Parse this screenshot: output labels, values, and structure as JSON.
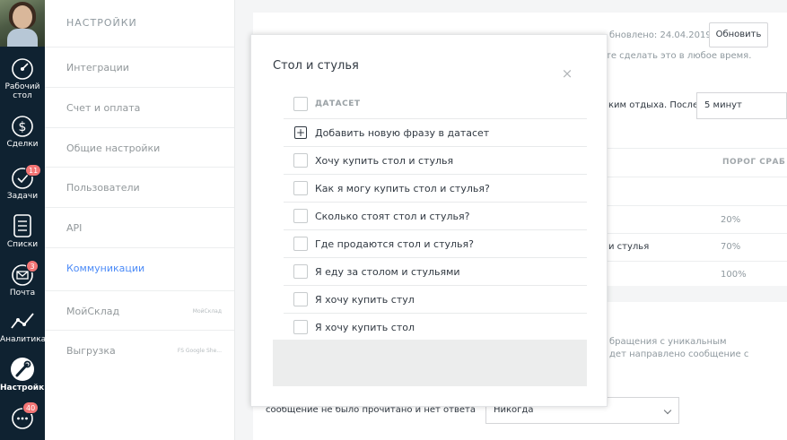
{
  "rail": {
    "items": [
      {
        "label": "Рабочий стол"
      },
      {
        "label": "Сделки"
      },
      {
        "label": "Задачи",
        "badge": "11"
      },
      {
        "label": "Списки"
      },
      {
        "label": "Почта",
        "badge": "3"
      },
      {
        "label": "Аналитика"
      },
      {
        "label": "Настройки"
      },
      {
        "label": "",
        "badge": "40"
      }
    ]
  },
  "menu": {
    "title": "НАСТРОЙКИ",
    "items": [
      {
        "label": "Интеграции"
      },
      {
        "label": "Счет и оплата"
      },
      {
        "label": "Общие настройки"
      },
      {
        "label": "Пользователи"
      },
      {
        "label": "API"
      },
      {
        "label": "Коммуникации"
      },
      {
        "label": "МойСклад",
        "sub": "МойСклад"
      },
      {
        "label": "Выгрузка",
        "sub": "FS Google She..."
      }
    ]
  },
  "background": {
    "refresh_button": "Обновить",
    "updated_text": "бновлено: 24.04.2019",
    "hint_text": "те сделать это в любое время.",
    "rest_text": "ким отдыха. После",
    "rest_select": "5 минут",
    "threshold_header": "ПОРОГ СРАБ",
    "percents": [
      "20%",
      "70%",
      "100%"
    ],
    "fragment_chairs": "и стулья",
    "unique_text_1": "бращения с уникальным",
    "unique_text_2": "дет направлено сообщение с",
    "unread_text": "сообщение не было прочитано и нет ответа",
    "never_select": "Никогда"
  },
  "modal": {
    "title": "Стол и стулья",
    "close": "×",
    "header": "ДАТАСЕТ",
    "add_phrase": "Добавить новую фразу в датасет",
    "phrases": [
      "Хочу купить стол и стулья",
      "Как я могу купить стол и стулья?",
      "Сколько стоят стол и стулья?",
      "Где продаются стол и стулья?",
      "Я еду за столом и стульями",
      "Я хочу купить стул",
      "Я хочу купить стол"
    ]
  }
}
